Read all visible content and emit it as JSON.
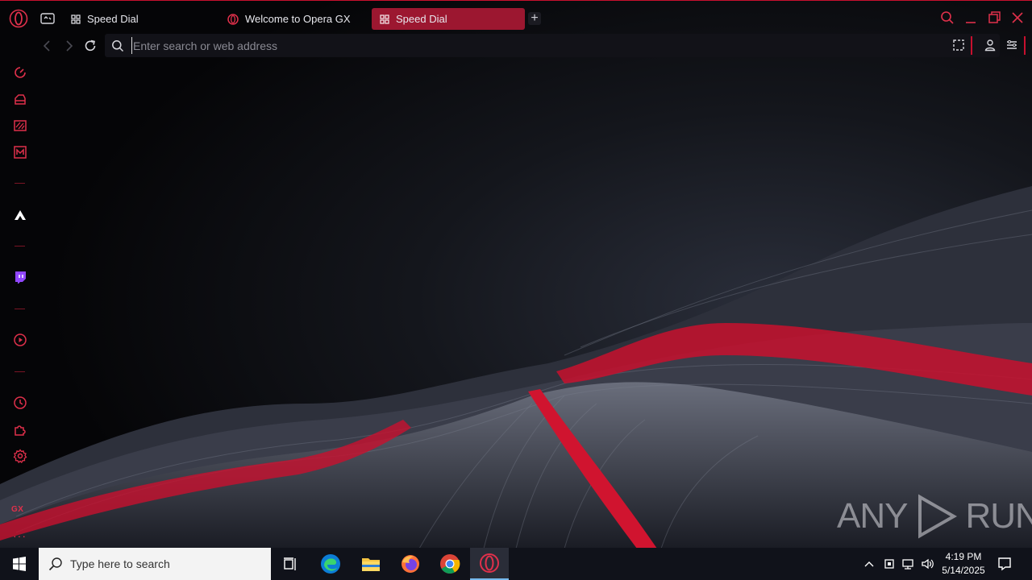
{
  "browser": {
    "tabs": [
      {
        "label": "Speed Dial",
        "icon": "speed-dial-icon",
        "active": false
      },
      {
        "label": "Welcome to Opera GX",
        "icon": "opera-icon",
        "active": false
      },
      {
        "label": "Speed Dial",
        "icon": "speed-dial-icon",
        "active": true
      }
    ],
    "new_tab_label": "+",
    "address_bar": {
      "placeholder": "Enter search or web address",
      "value": ""
    },
    "accent_color": "#c8102e"
  },
  "sidebar": {
    "items": [
      "gx-control-icon",
      "gx-corner-icon",
      "news-icon",
      "player-icon",
      "aria-icon",
      "twitch-icon",
      "music-player-icon",
      "history-icon",
      "extensions-icon",
      "settings-icon"
    ],
    "gx_label": "GX",
    "more_label": "···"
  },
  "watermark": {
    "text_left": "ANY",
    "text_right": "RUN"
  },
  "taskbar": {
    "search_placeholder": "Type here to search",
    "apps": [
      "task-view-icon",
      "edge-icon",
      "file-explorer-icon",
      "firefox-icon",
      "chrome-icon",
      "opera-gx-icon"
    ],
    "clock_time": "4:19 PM",
    "clock_date": "5/14/2025"
  }
}
